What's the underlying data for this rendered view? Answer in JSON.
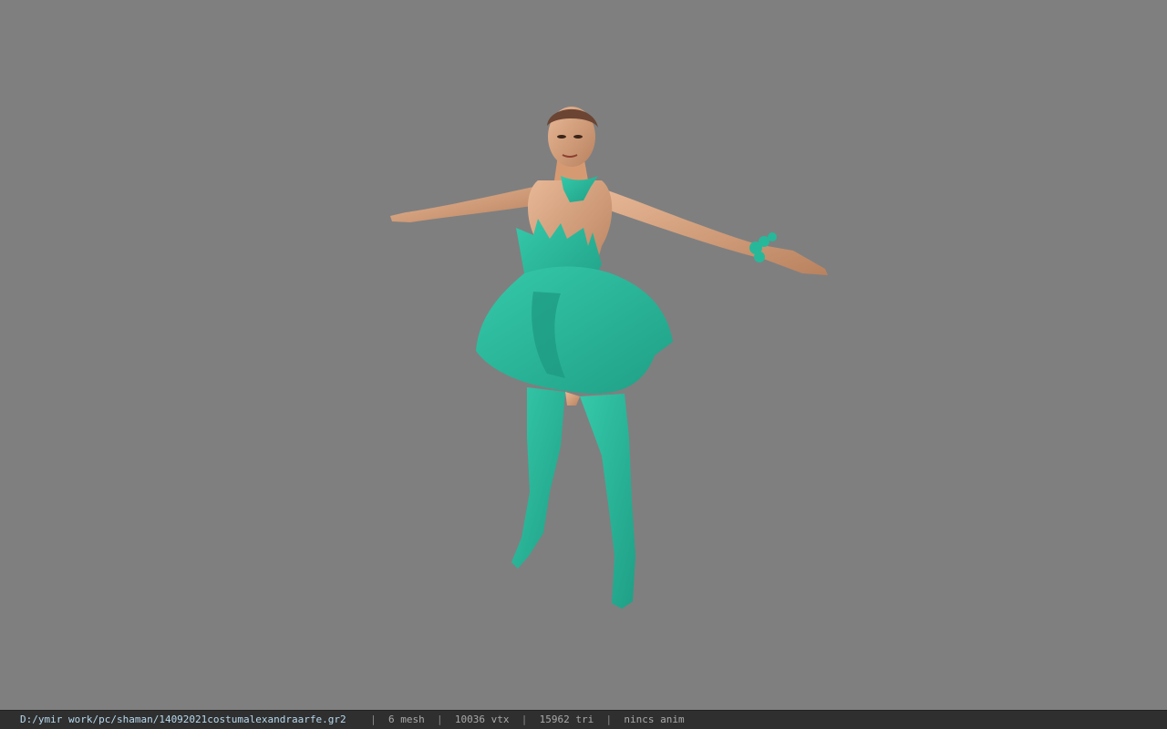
{
  "viewport": {
    "background_color": "#7f7f7f",
    "model_icon": "character-model-tpose",
    "costume_color": "#27b89a",
    "skin_color": "#d9a37f"
  },
  "statusbar": {
    "file_path": "D:/ymir work/pc/shaman/14092021costumalexandraarfe.gr2",
    "separator": "|",
    "mesh_count": "6 mesh",
    "vertex_count": "10036 vtx",
    "triangle_count": "15962 tri",
    "anim_status": "nincs anim"
  }
}
